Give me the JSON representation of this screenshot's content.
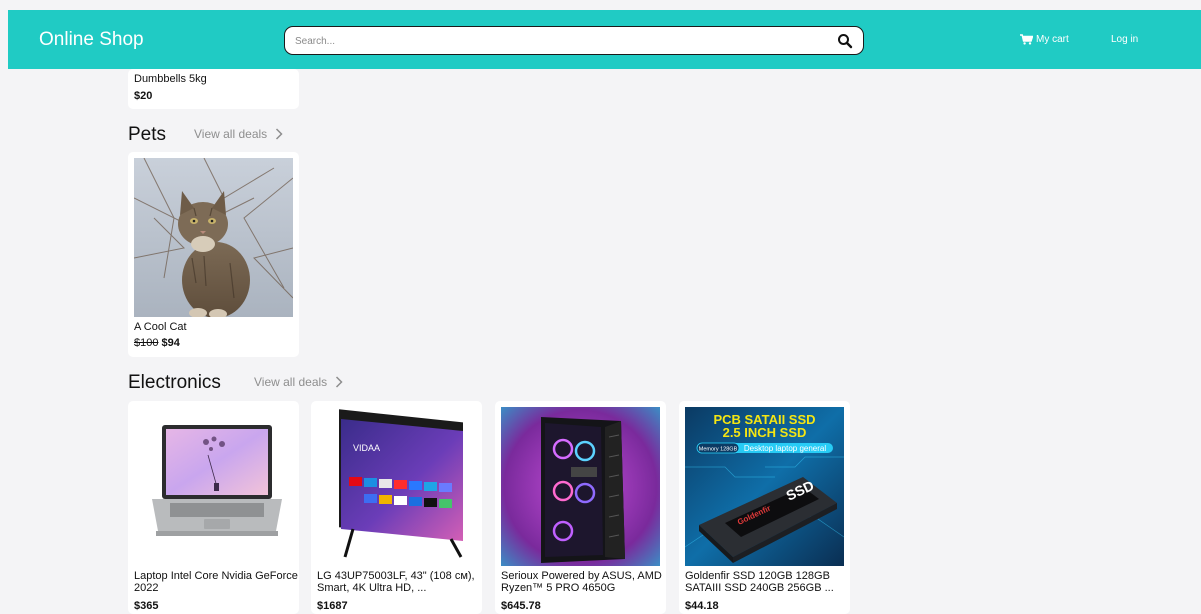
{
  "header": {
    "brand": "Online Shop",
    "search_placeholder": "Search...",
    "cart_label": "My cart",
    "login_label": "Log in"
  },
  "partial_card": {
    "name": "Dumbbells 5kg",
    "price": "$20"
  },
  "sections": {
    "pets": {
      "title": "Pets",
      "view_all": "View all deals",
      "items": [
        {
          "name": "A Cool Cat",
          "old_price": "$100",
          "price": "$94"
        }
      ]
    },
    "electronics": {
      "title": "Electronics",
      "view_all": "View all deals",
      "items": [
        {
          "name": "Laptop Intel Core Nvidia GeForce 2022",
          "price": "$365"
        },
        {
          "name": "LG 43UP75003LF, 43\" (108 см), Smart, 4K Ultra HD, ...",
          "price": "$1687"
        },
        {
          "name": "Serioux Powered by ASUS, AMD Ryzen™ 5 PRO 4650G",
          "price": "$645.78"
        },
        {
          "name": "Goldenfir SSD 120GB 128GB SATAIII SSD 240GB 256GB ...",
          "price": "$44.18"
        }
      ]
    }
  },
  "product_images": {
    "ssd_banner_line1": "PCB SATAII SSD",
    "ssd_banner_line2": "2.5 INCH SSD",
    "ssd_tag_memory": "Memory 128GB",
    "ssd_tag_desc": "Desktop laptop general",
    "ssd_label_text": "SSD",
    "ssd_brand_text": "Goldenfir"
  },
  "colors": {
    "accent": "#20cbc4",
    "background": "#f4f4f6"
  }
}
